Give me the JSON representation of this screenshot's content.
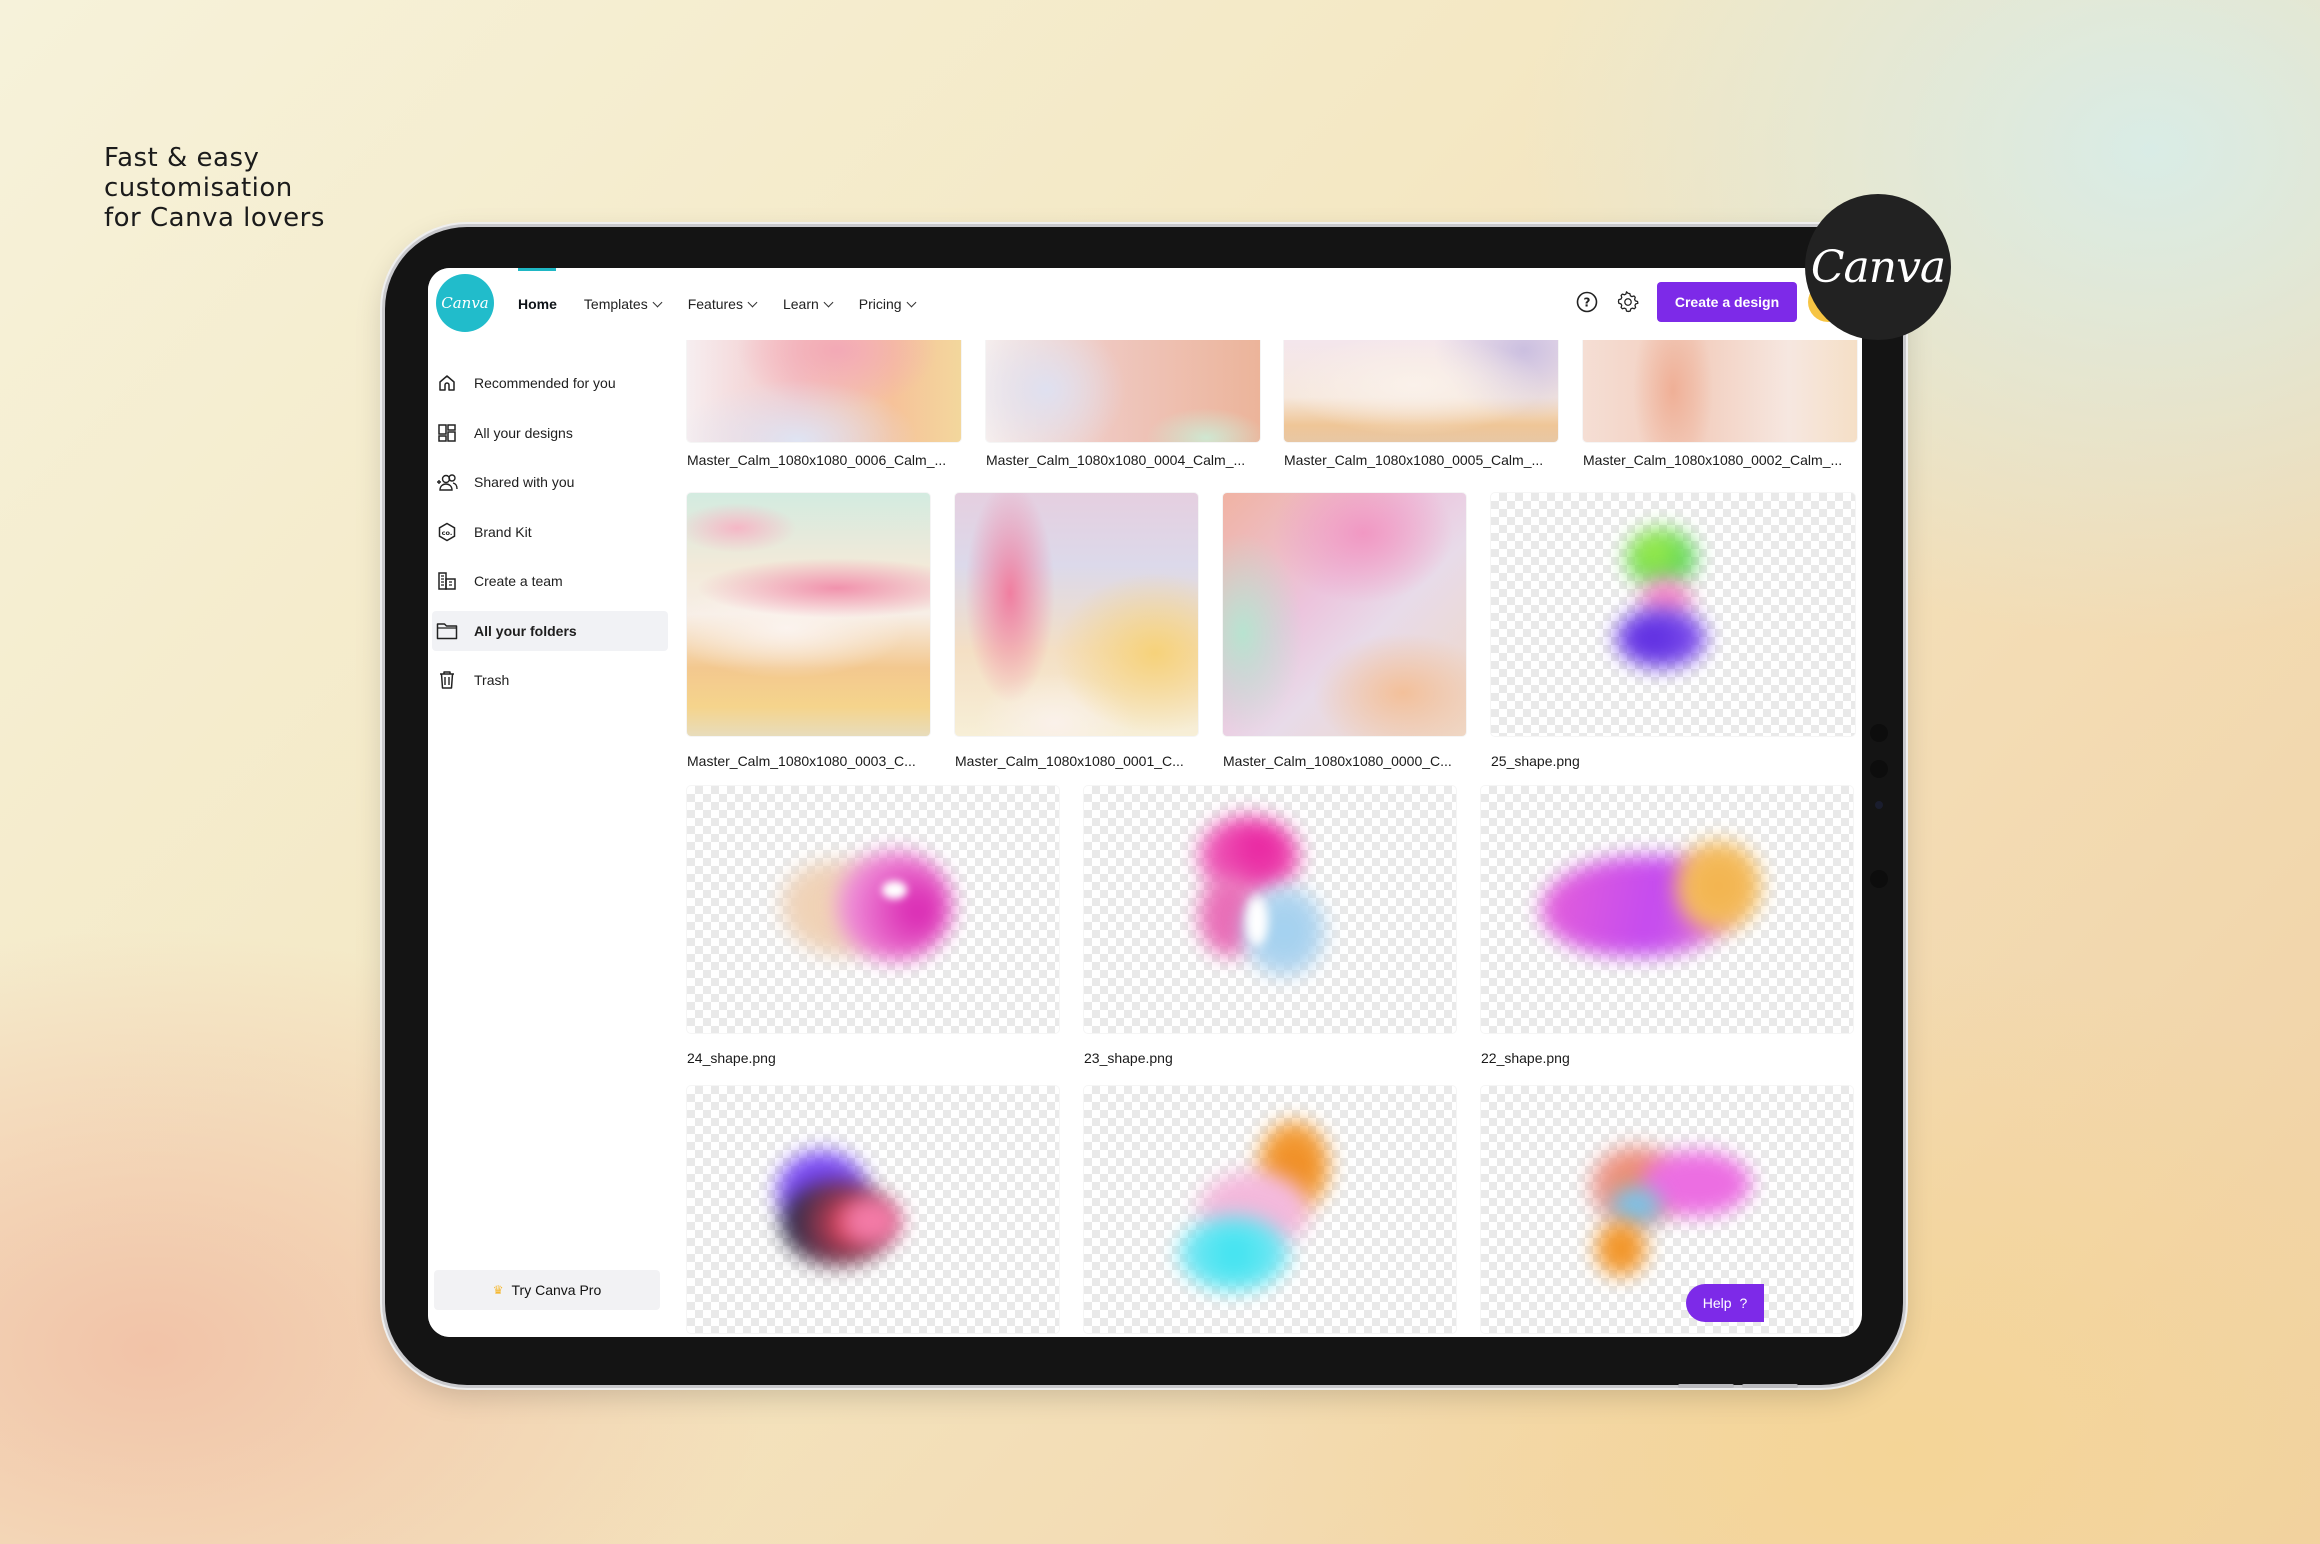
{
  "tagline": [
    "Fast & easy",
    "customisation",
    "for Canva lovers"
  ],
  "badge": {
    "text": "Canva"
  },
  "app": {
    "logo_text": "Canva",
    "brand_color": "#21bccb",
    "accent_color": "#7d2ae8",
    "nav": [
      {
        "label": "Home",
        "dropdown": false
      },
      {
        "label": "Templates",
        "dropdown": true
      },
      {
        "label": "Features",
        "dropdown": true
      },
      {
        "label": "Learn",
        "dropdown": true
      },
      {
        "label": "Pricing",
        "dropdown": true
      }
    ],
    "toolbar": {
      "help_icon": "help-circle-icon",
      "settings_icon": "gear-icon",
      "create_label": "Create a design"
    },
    "sidebar": {
      "items": [
        {
          "label": "Recommended for you",
          "icon": "home-icon",
          "active": false
        },
        {
          "label": "All your designs",
          "icon": "grid-icon",
          "active": false
        },
        {
          "label": "Shared with you",
          "icon": "shared-users-icon",
          "active": false
        },
        {
          "label": "Brand Kit",
          "icon": "brand-kit-icon",
          "active": false
        },
        {
          "label": "Create a team",
          "icon": "team-building-icon",
          "active": false
        },
        {
          "label": "All your folders",
          "icon": "folder-icon",
          "active": true
        },
        {
          "label": "Trash",
          "icon": "trash-icon",
          "active": false
        }
      ],
      "try_pro": "Try Canva Pro"
    },
    "files": {
      "row1": [
        "Master_Calm_1080x1080_0006_Calm_...",
        "Master_Calm_1080x1080_0004_Calm_...",
        "Master_Calm_1080x1080_0005_Calm_...",
        "Master_Calm_1080x1080_0002_Calm_..."
      ],
      "row2": [
        "Master_Calm_1080x1080_0003_C...",
        "Master_Calm_1080x1080_0001_C...",
        "Master_Calm_1080x1080_0000_C...",
        "25_shape.png"
      ],
      "row3": [
        "24_shape.png",
        "23_shape.png",
        "22_shape.png"
      ],
      "row4": [
        "",
        "",
        ""
      ]
    },
    "help_button": {
      "label": "Help",
      "icon": "?"
    }
  }
}
